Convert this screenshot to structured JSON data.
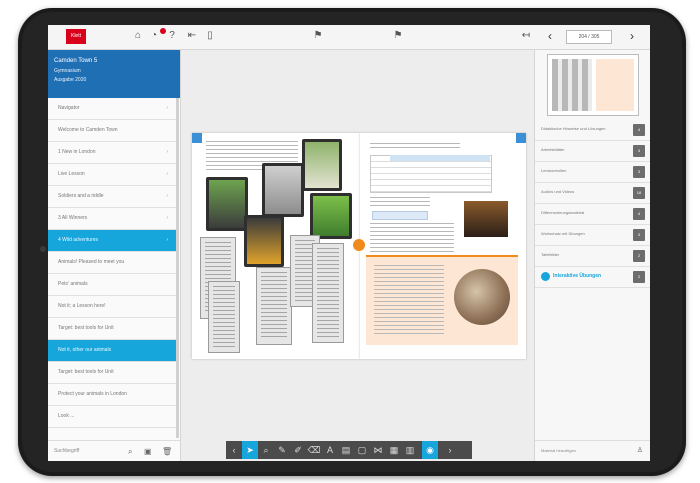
{
  "topbar": {
    "logo_text": "Klett",
    "page_indicator": "204 / 305"
  },
  "sidebar": {
    "book_title": "Camden Town 5",
    "book_subtitle": "Gymnasium",
    "book_edition": "Ausgabe 2020",
    "items": [
      {
        "label": "Navigator",
        "arrow": "›"
      },
      {
        "label": "Welcome to Camden Town",
        "arrow": ""
      },
      {
        "label": "1 New in London",
        "arrow": "›"
      },
      {
        "label": "Live Lesson",
        "arrow": "›"
      },
      {
        "label": "Soldiers and a riddle",
        "arrow": "›"
      },
      {
        "label": "3 All Winners",
        "arrow": "›"
      },
      {
        "label": "4 Wild adventures",
        "arrow": "›"
      },
      {
        "label": "Animals! Pleased to meet you",
        "arrow": ""
      },
      {
        "label": "Pets' animals",
        "arrow": ""
      },
      {
        "label": "Not it; a Lesson here!",
        "arrow": ""
      },
      {
        "label": "Target: best tools for Unit",
        "arrow": ""
      },
      {
        "label": "Not it, other our animals",
        "arrow": ""
      },
      {
        "label": "Target: best tools for Unit",
        "arrow": ""
      },
      {
        "label": "Protect your animals in London",
        "arrow": ""
      },
      {
        "label": "Look ...",
        "arrow": ""
      }
    ],
    "search_placeholder": "Suchbegriff"
  },
  "right_panel": {
    "items": [
      {
        "label": "Didaktische Hinweise und Lösungen",
        "count": "4"
      },
      {
        "label": "Arbeitsblätter",
        "count": "4"
      },
      {
        "label": "Lernkontrollen",
        "count": "3"
      },
      {
        "label": "Audios und Videos",
        "count": "18"
      },
      {
        "label": "Differenzierungsmaterial",
        "count": "4"
      },
      {
        "label": "Wortschatz mit Übungen",
        "count": "3"
      },
      {
        "label": "Tafelbilder",
        "count": "2"
      },
      {
        "label": "Interaktive Übungen",
        "count": "2"
      }
    ],
    "footer_label": "Material hinzufügen",
    "accent": "#17a6dc"
  },
  "colors": {
    "brand_red": "#d9001b",
    "header_blue": "#1f6fb5",
    "active_blue": "#17a6dc"
  }
}
